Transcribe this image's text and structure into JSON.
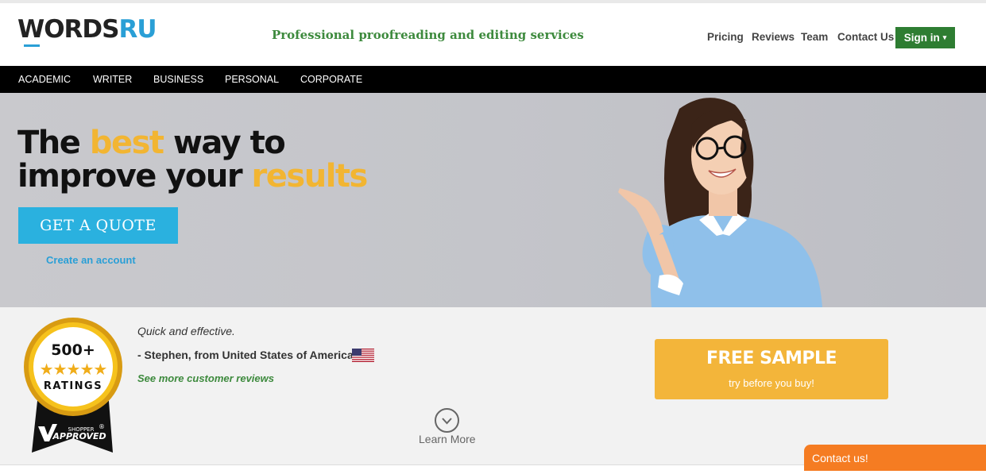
{
  "header": {
    "logo_words": "WORDS",
    "logo_ru": "RU",
    "tagline": "Professional proofreading and editing services",
    "nav": [
      "Pricing",
      "Reviews",
      "Team",
      "Contact Us"
    ],
    "signin_label": "Sign in",
    "signin_caret": "▾"
  },
  "categories": [
    "ACADEMIC",
    "WRITER",
    "BUSINESS",
    "PERSONAL",
    "CORPORATE"
  ],
  "hero": {
    "title_the": "The ",
    "title_best": "best",
    "title_way": " way to",
    "title_improve": "improve your ",
    "title_results": "results",
    "cta_label": "GET A QUOTE",
    "create_account": "Create an account"
  },
  "review": {
    "quote": "Quick and effective.",
    "author": "- Stephen, from United States of America",
    "more_link": "See more customer reviews",
    "learn_more": "Learn More"
  },
  "badge": {
    "count": "500+",
    "stars": "★★★★★",
    "label": "RATINGS",
    "shopper": "SHOPPER",
    "approved": "APPROVED",
    "registered": "®"
  },
  "free_sample": {
    "title": "FREE SAMPLE",
    "subtitle": "try before you buy!"
  },
  "contact_tab": "Contact us!",
  "colors": {
    "accent_yellow": "#f2b532",
    "brand_blue": "#2ab1df",
    "brand_green": "#2e7d32",
    "contact_orange": "#f57c22"
  }
}
